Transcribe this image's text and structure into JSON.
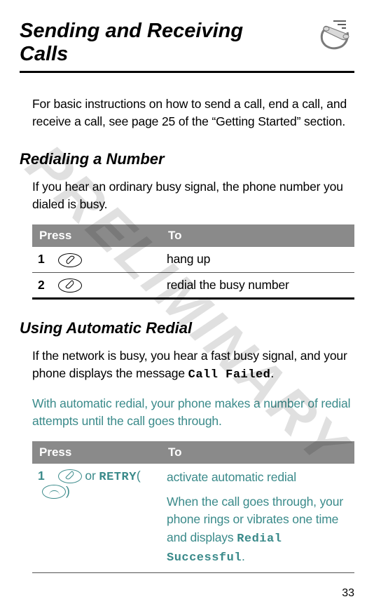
{
  "watermark": "PRELIMINARY",
  "page_title": "Sending and Receiving Calls",
  "intro": "For basic instructions on how to send a call, end a call, and receive a call, see page 25 of the “Getting Started” section.",
  "section1": {
    "heading": "Redialing a Number",
    "body": "If you hear an ordinary busy signal, the phone number you dialed is busy.",
    "table": {
      "headers": {
        "press": "Press",
        "to": "To"
      },
      "rows": [
        {
          "num": "1",
          "to": "hang up"
        },
        {
          "num": "2",
          "to": "redial the busy number"
        }
      ]
    }
  },
  "section2": {
    "heading": "Using Automatic Redial",
    "body_prefix": "If the network is busy, you hear a fast busy signal, and your phone displays the message ",
    "body_code": "Call Failed",
    "body_suffix": ".",
    "teal_body": "With automatic redial, your phone makes a number of redial attempts until the call goes through.",
    "table": {
      "headers": {
        "press": "Press",
        "to": "To"
      },
      "rows": [
        {
          "num": "1",
          "press_or": " or ",
          "press_retry": "RETRY",
          "press_paren_open": "(",
          "press_paren_close": ")",
          "to_line1": "activate automatic redial",
          "to_line2_prefix": "When the call goes through, your phone rings or vibrates one time and displays ",
          "to_line2_code": "Redial Successful",
          "to_line2_suffix": "."
        }
      ]
    }
  },
  "page_number": "33"
}
